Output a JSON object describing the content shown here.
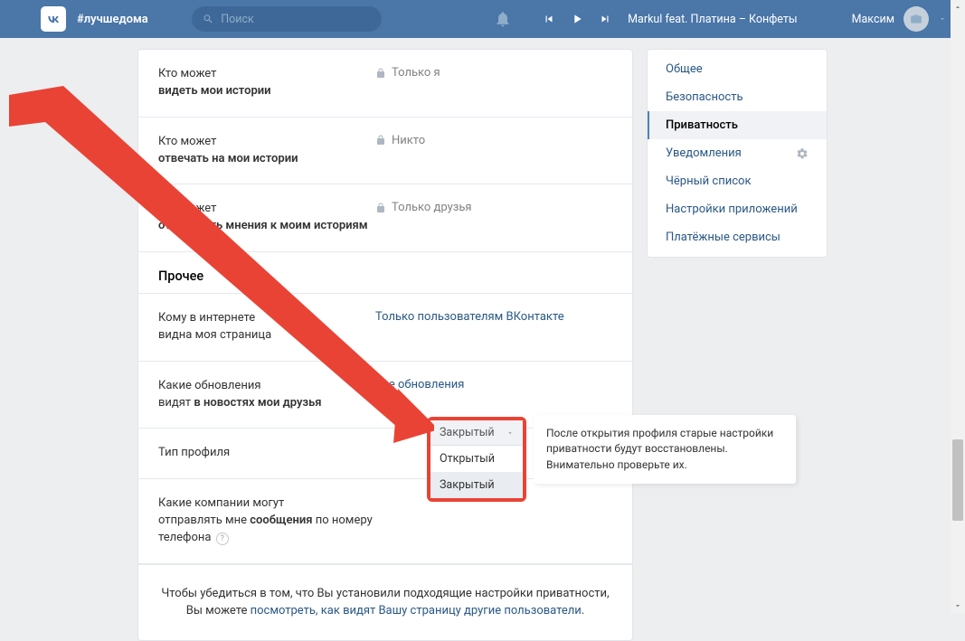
{
  "topbar": {
    "hashtag": "#лучшедома",
    "search_placeholder": "Поиск",
    "track": "Markul feat. Платина – Конфеты",
    "user_name": "Максим"
  },
  "settings": {
    "rows": [
      {
        "q": "Кто может",
        "b": "видеть мои истории",
        "val": "Только я",
        "locked": true
      },
      {
        "q": "Кто может",
        "b": "отвечать на мои истории",
        "val": "Никто",
        "locked": true
      },
      {
        "q": "Кто может",
        "b": "отправлять мнения к моим историям",
        "val": "Только друзья",
        "locked": true
      }
    ],
    "section_title": "Прочее",
    "other_rows": {
      "page_visible_q": "Кому в интернете",
      "page_visible_b": "видна моя страница",
      "page_visible_val": "Только пользователям ВКонтакте",
      "updates_q": "Какие обновления",
      "updates_b": "видят в новостях мои друзья",
      "updates_val": "Все обновления",
      "profile_type_label": "Тип профиля",
      "companies_q": "Какие компании могут",
      "companies_mid1": "отправлять мне ",
      "companies_b": "сообщения",
      "companies_mid2": " по номеру телефона"
    },
    "footer_text1": "Чтобы убедиться в том, что Вы установили подходящие настройки приватности,",
    "footer_text2": "Вы можете ",
    "footer_link": "посмотреть, как видят Вашу страницу другие пользователи"
  },
  "sidebar": {
    "items": [
      "Общее",
      "Безопасность",
      "Приватность",
      "Уведомления",
      "Чёрный список",
      "Настройки приложений",
      "Платёжные сервисы"
    ],
    "active_index": 2,
    "gear_on_index": 3
  },
  "dropdown": {
    "selected": "Закрытый",
    "options": [
      "Открытый",
      "Закрытый"
    ]
  },
  "tooltip": "После открытия профиля старые настройки приватности будут восстановлены. Внимательно проверьте их."
}
